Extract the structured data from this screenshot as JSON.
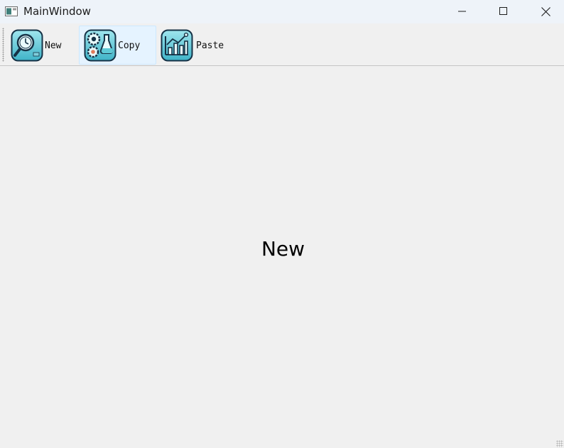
{
  "window": {
    "title": "MainWindow"
  },
  "toolbar": {
    "items": [
      {
        "label": "New",
        "icon": "clock-magnifier-icon"
      },
      {
        "label": "Copy",
        "icon": "gears-flask-icon"
      },
      {
        "label": "Paste",
        "icon": "bar-chart-icon"
      }
    ],
    "hovered_index": 1
  },
  "central": {
    "label": "New"
  },
  "colors": {
    "titlebar": "#eef3f9",
    "background": "#f0f0f0",
    "icon_teal": "#5ec9d6",
    "icon_dark": "#1a3a52",
    "hover_bg": "#e5f3ff"
  }
}
